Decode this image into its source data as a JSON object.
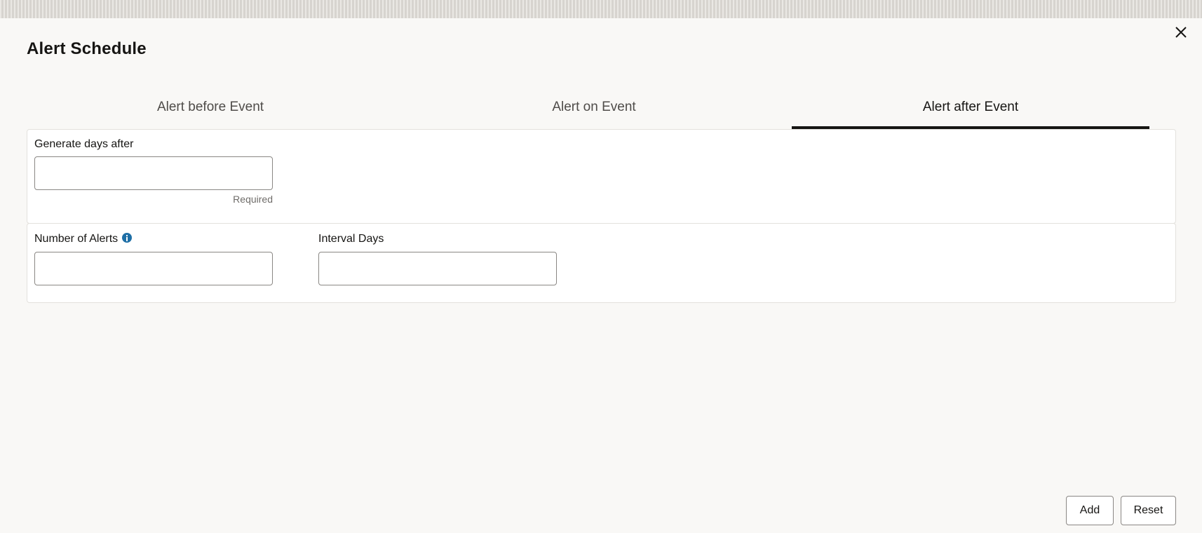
{
  "dialog": {
    "title": "Alert Schedule",
    "close_icon": "close-icon"
  },
  "tabs": [
    {
      "label": "Alert before Event",
      "selected": false
    },
    {
      "label": "Alert on Event",
      "selected": false
    },
    {
      "label": "Alert after Event",
      "selected": true
    }
  ],
  "form": {
    "generate_days_after": {
      "label": "Generate days after",
      "value": "",
      "helper": "Required"
    },
    "number_of_alerts": {
      "label": "Number of Alerts",
      "value": "",
      "icon": "info-icon"
    },
    "interval_days": {
      "label": "Interval Days",
      "value": ""
    }
  },
  "actions": {
    "add_label": "Add",
    "reset_label": "Reset"
  },
  "colors": {
    "background": "#f9f8f6",
    "text": "#161513",
    "info_icon": "#1e6fa6",
    "active_tab_underline": "#161513"
  }
}
